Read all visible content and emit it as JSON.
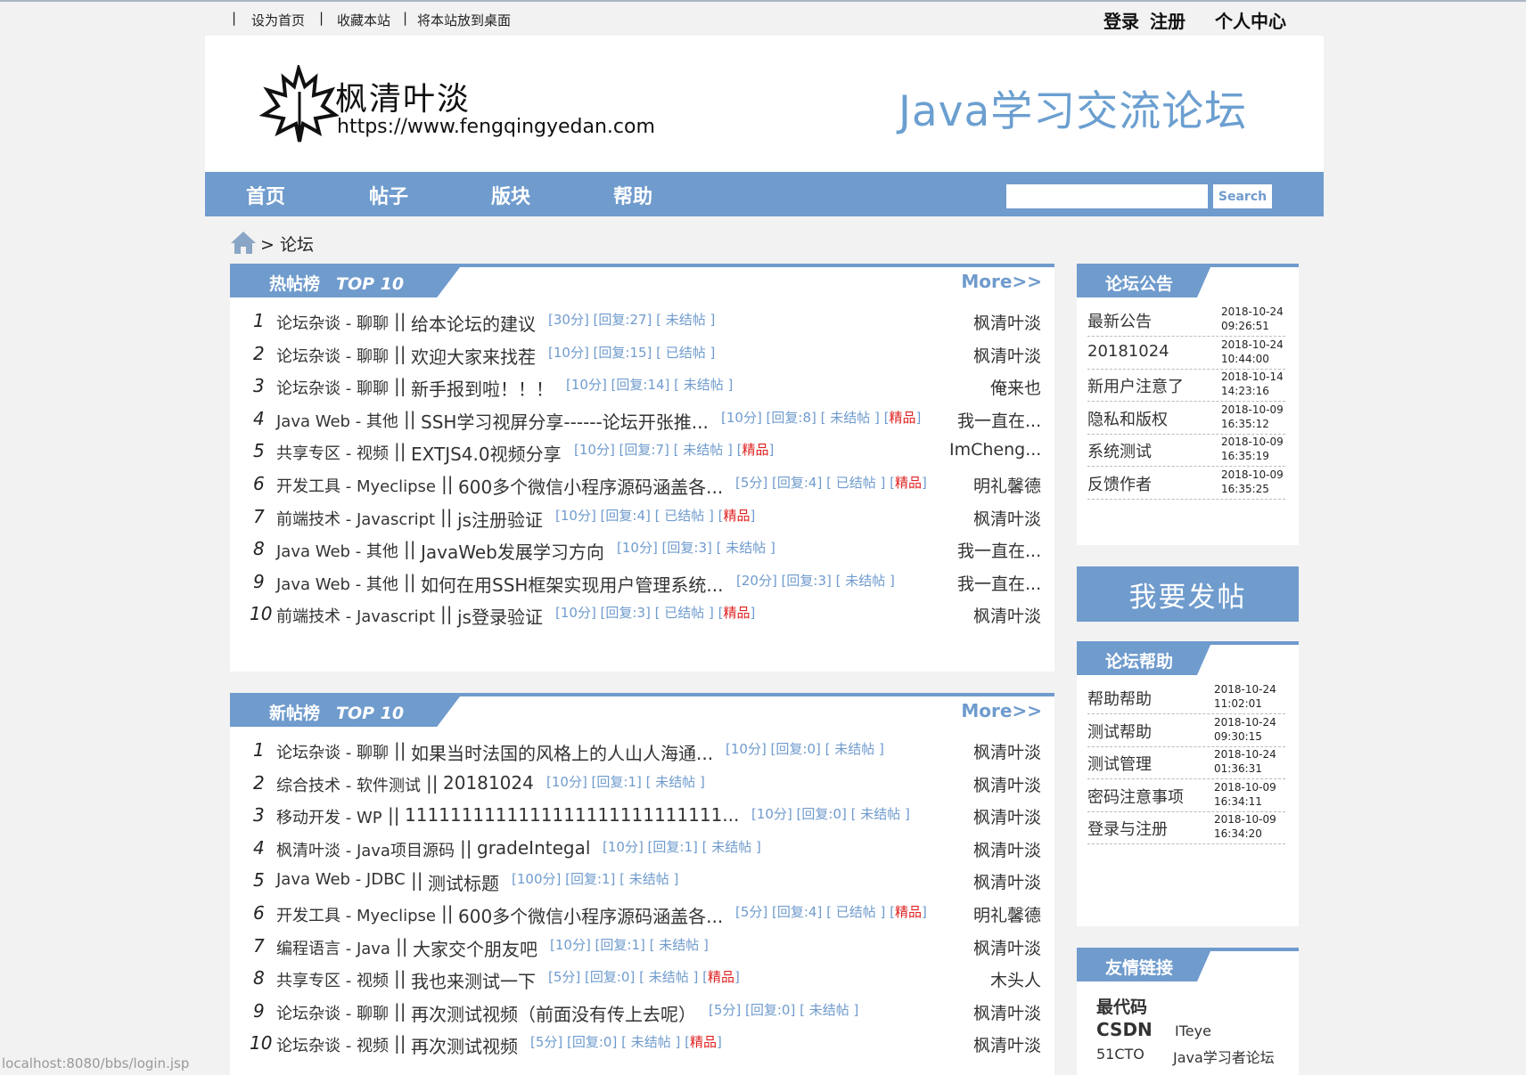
{
  "topbar": {
    "links": [
      "设为首页",
      "收藏本站",
      "将本站放到桌面"
    ],
    "login": "登录",
    "register": "注册",
    "user_center": "个人中心"
  },
  "header": {
    "logo_name": "枫清叶淡",
    "logo_url": "https://www.fengqingyedan.com",
    "forum_title": "Java学习交流论坛"
  },
  "nav": {
    "items": [
      "首页",
      "帖子",
      "版块",
      "帮助"
    ],
    "search_label": "Search",
    "search_value": ""
  },
  "breadcrumb": {
    "text": "> 论坛"
  },
  "hot": {
    "label": "热帖榜",
    "top": "TOP 10",
    "more": "More>>",
    "rows": [
      {
        "num": "1",
        "cat": "论坛杂谈 - 聊聊",
        "title": "给本论坛的建议",
        "meta": "[30分] [回复:27] [ 未结帖 ]",
        "jing": "",
        "author": "枫清叶淡"
      },
      {
        "num": "2",
        "cat": "论坛杂谈 - 聊聊",
        "title": "欢迎大家来找茬",
        "meta": "[10分] [回复:15] [ 已结帖 ]",
        "jing": "",
        "author": "枫清叶淡"
      },
      {
        "num": "3",
        "cat": "论坛杂谈 - 聊聊",
        "title": "新手报到啦！！！",
        "meta": "[10分] [回复:14] [ 未结帖 ]",
        "jing": "",
        "author": "俺来也"
      },
      {
        "num": "4",
        "cat": "Java Web - 其他",
        "title": "SSH学习视屏分享------论坛开张推...",
        "meta": "[10分] [回复:8] [ 未结帖 ] [",
        "jing": "精品",
        "author": "我一直在..."
      },
      {
        "num": "5",
        "cat": "共享专区 - 视频",
        "title": "EXTJS4.0视频分享",
        "meta": "[10分] [回复:7] [ 未结帖 ] [",
        "jing": "精品",
        "author": "ImCheng..."
      },
      {
        "num": "6",
        "cat": "开发工具 - Myeclipse",
        "title": "600多个微信小程序源码涵盖各...",
        "meta": "[5分] [回复:4] [ 已结帖 ] [",
        "jing": "精品",
        "author": "明礼馨德"
      },
      {
        "num": "7",
        "cat": "前端技术 - Javascript",
        "title": "js注册验证",
        "meta": "[10分] [回复:4] [ 已结帖 ] [",
        "jing": "精品",
        "author": "枫清叶淡"
      },
      {
        "num": "8",
        "cat": "Java Web - 其他",
        "title": "JavaWeb发展学习方向",
        "meta": "[10分] [回复:3] [ 未结帖 ]",
        "jing": "",
        "author": "我一直在..."
      },
      {
        "num": "9",
        "cat": "Java Web - 其他",
        "title": "如何在用SSH框架实现用户管理系统...",
        "meta": "[20分] [回复:3] [ 未结帖 ]",
        "jing": "",
        "author": "我一直在..."
      },
      {
        "num": "10",
        "cat": "前端技术 - Javascript",
        "title": "js登录验证",
        "meta": "[10分] [回复:3] [ 已结帖 ] [",
        "jing": "精品",
        "author": "枫清叶淡"
      }
    ]
  },
  "new": {
    "label": "新帖榜",
    "top": "TOP 10",
    "more": "More>>",
    "rows": [
      {
        "num": "1",
        "cat": "论坛杂谈 - 聊聊",
        "title": "如果当时法国的风格上的人山人海通...",
        "meta": "[10分] [回复:0] [ 未结帖 ]",
        "jing": "",
        "author": "枫清叶淡"
      },
      {
        "num": "2",
        "cat": "综合技术 - 软件测试",
        "title": "20181024",
        "meta": "[10分] [回复:1] [ 未结帖 ]",
        "jing": "",
        "author": "枫清叶淡"
      },
      {
        "num": "3",
        "cat": "移动开发 - WP",
        "title": "1111111111111111111111111111...",
        "meta": "[10分] [回复:0] [ 未结帖 ]",
        "jing": "",
        "author": "枫清叶淡"
      },
      {
        "num": "4",
        "cat": "枫清叶淡 - Java项目源码",
        "title": "gradeIntegal",
        "meta": "[10分] [回复:1] [ 未结帖 ]",
        "jing": "",
        "author": "枫清叶淡"
      },
      {
        "num": "5",
        "cat": "Java Web - JDBC",
        "title": "测试标题",
        "meta": "[100分] [回复:1] [ 未结帖 ]",
        "jing": "",
        "author": "枫清叶淡"
      },
      {
        "num": "6",
        "cat": "开发工具 - Myeclipse",
        "title": "600多个微信小程序源码涵盖各...",
        "meta": "[5分] [回复:4] [ 已结帖 ] [",
        "jing": "精品",
        "author": "明礼馨德"
      },
      {
        "num": "7",
        "cat": "编程语言 - Java",
        "title": "大家交个朋友吧",
        "meta": "[10分] [回复:1] [ 未结帖 ]",
        "jing": "",
        "author": "枫清叶淡"
      },
      {
        "num": "8",
        "cat": "共享专区 - 视频",
        "title": "我也来测试一下",
        "meta": "[5分] [回复:0] [ 未结帖 ] [",
        "jing": "精品",
        "author": "木头人"
      },
      {
        "num": "9",
        "cat": "论坛杂谈 - 聊聊",
        "title": "再次测试视频（前面没有传上去呢）",
        "meta": "[5分] [回复:0] [ 未结帖 ]",
        "jing": "",
        "author": "枫清叶淡"
      },
      {
        "num": "10",
        "cat": "论坛杂谈 - 视频",
        "title": "再次测试视频",
        "meta": "[5分] [回复:0] [ 未结帖 ] [",
        "jing": "精品",
        "author": "枫清叶淡"
      }
    ]
  },
  "notice": {
    "label": "论坛公告",
    "items": [
      {
        "title": "最新公告",
        "date": "2018-10-24",
        "time": "09:26:51"
      },
      {
        "title": "20181024",
        "date": "2018-10-24",
        "time": "10:44:00"
      },
      {
        "title": "新用户注意了",
        "date": "2018-10-14",
        "time": "14:23:16"
      },
      {
        "title": "隐私和版权",
        "date": "2018-10-09",
        "time": "16:35:12"
      },
      {
        "title": "系统测试",
        "date": "2018-10-09",
        "time": "16:35:19"
      },
      {
        "title": "反馈作者",
        "date": "2018-10-09",
        "time": "16:35:25"
      }
    ]
  },
  "post_button": "我要发帖",
  "help": {
    "label": "论坛帮助",
    "items": [
      {
        "title": "帮助帮助",
        "date": "2018-10-24",
        "time": "11:02:01"
      },
      {
        "title": "测试帮助",
        "date": "2018-10-24",
        "time": "09:30:15"
      },
      {
        "title": "测试管理",
        "date": "2018-10-24",
        "time": "01:36:31"
      },
      {
        "title": "密码注意事项",
        "date": "2018-10-09",
        "time": "16:34:11"
      },
      {
        "title": "登录与注册",
        "date": "2018-10-09",
        "time": "16:34:20"
      }
    ]
  },
  "links": {
    "label": "友情链接",
    "items": [
      "最代码",
      "CSDN",
      "ITeye",
      "51CTO",
      "Java学习者论坛"
    ]
  },
  "status_bar": "localhost:8080/bbs/login.jsp",
  "colors": {
    "accent": "#6f9bcd",
    "jing": "#e02020"
  }
}
